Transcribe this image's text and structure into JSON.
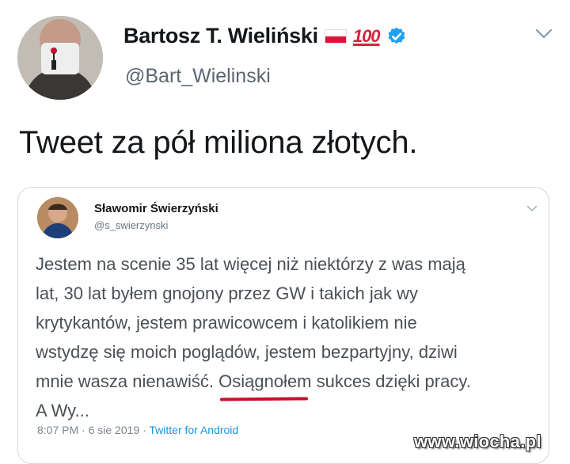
{
  "author": {
    "name": "Bartosz T. Wieliński",
    "hundred_emoji": "100",
    "handle": "@Bart_Wielinski",
    "flag_icon": "poland-flag-icon",
    "verified_icon": "verified-badge-icon"
  },
  "tweet": {
    "text": "Tweet za pół miliona złotych."
  },
  "quoted": {
    "name": "Sławomir Świerzyński",
    "handle": "@s_swierzynski",
    "lines": [
      "Jestem na scenie 35 lat więcej niż niektórzy z was mają",
      "lat, 30 lat byłem gnojony przez GW i takich jak wy",
      "krytykantów, jestem prawicowcem i katolikiem nie",
      "wstydzę się moich poglądów, jestem bezpartyjny, dziwi"
    ],
    "line5_before": "mnie wasza nienawiść. ",
    "line5_underlined": "Osiągnołem",
    "line5_after": " sukces dzięki pracy.",
    "line6": "A Wy...",
    "meta": "8:07 PM · 6 sie 2019 · ",
    "source": "Twitter for Android"
  },
  "watermark": "www.wiocha.pl",
  "colors": {
    "verified": "#1da1f2",
    "underline_mark": "#c8102e",
    "link": "#1b95e0"
  }
}
